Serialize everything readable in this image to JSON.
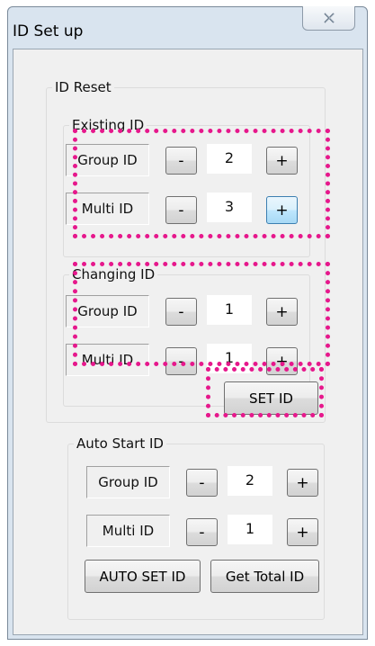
{
  "window": {
    "title": "ID Set up",
    "close_glyph": "☒"
  },
  "id_reset": {
    "label": "ID Reset",
    "existing": {
      "label": "Existing ID",
      "group_label": "Group ID",
      "group_value": "2",
      "multi_label": "Multi ID",
      "multi_value": "3"
    },
    "changing": {
      "label": "Changing ID",
      "group_label": "Group ID",
      "group_value": "1",
      "multi_label": "Multi ID",
      "multi_value": "1"
    },
    "set_button": "SET ID"
  },
  "auto_start": {
    "label": "Auto Start ID",
    "group_label": "Group ID",
    "group_value": "2",
    "multi_label": "Multi ID",
    "multi_value": "1",
    "auto_set_button": "AUTO SET ID",
    "total_button": "Get Total ID"
  },
  "buttons": {
    "minus": "-",
    "plus": "+"
  },
  "colors": {
    "highlight": "#e6188c",
    "hover_button": "#bee6fd"
  }
}
